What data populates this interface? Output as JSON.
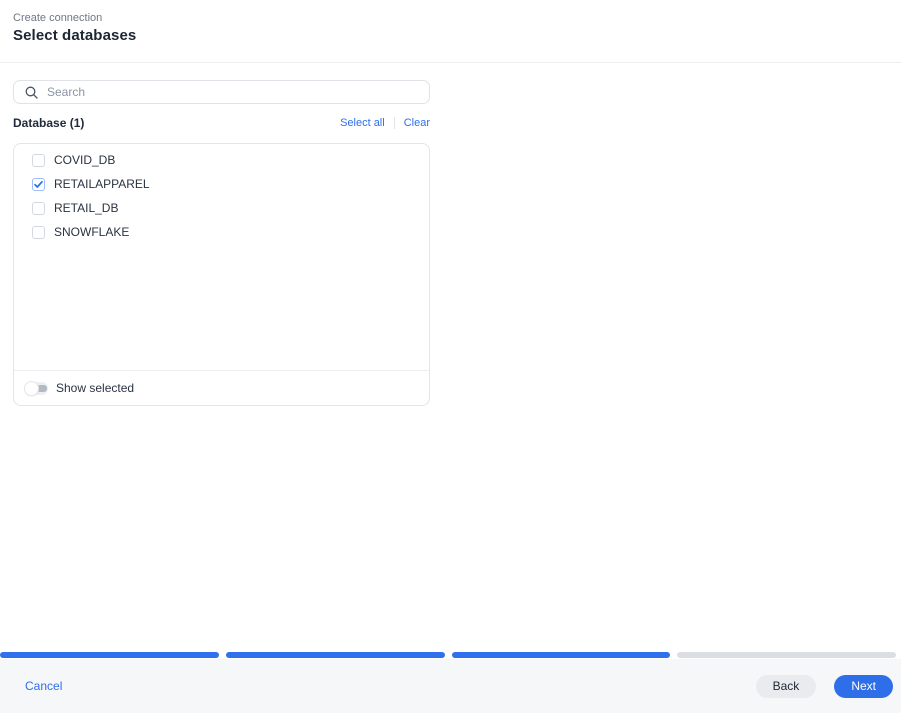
{
  "header": {
    "breadcrumb": "Create connection",
    "title": "Select databases"
  },
  "search": {
    "placeholder": "Search",
    "value": "",
    "icon": "search-icon"
  },
  "list": {
    "label": "Database (1)",
    "select_all_label": "Select all",
    "clear_label": "Clear",
    "items": [
      {
        "name": "COVID_DB",
        "checked": false
      },
      {
        "name": "RETAILAPPAREL",
        "checked": true
      },
      {
        "name": "RETAIL_DB",
        "checked": false
      },
      {
        "name": "SNOWFLAKE",
        "checked": false
      }
    ],
    "show_selected_label": "Show selected",
    "show_selected_on": false
  },
  "progress": {
    "total_steps": 4,
    "completed_steps": 3
  },
  "footer": {
    "cancel_label": "Cancel",
    "back_label": "Back",
    "next_label": "Next"
  },
  "colors": {
    "accent": "#2e6ee9",
    "progress_filled": "#3170ec",
    "progress_remaining": "#dbdee3",
    "checkbox_checked_border": "#9fbdf8",
    "checkmark": "#2b6de8",
    "footer_background": "#f6f7f9"
  }
}
